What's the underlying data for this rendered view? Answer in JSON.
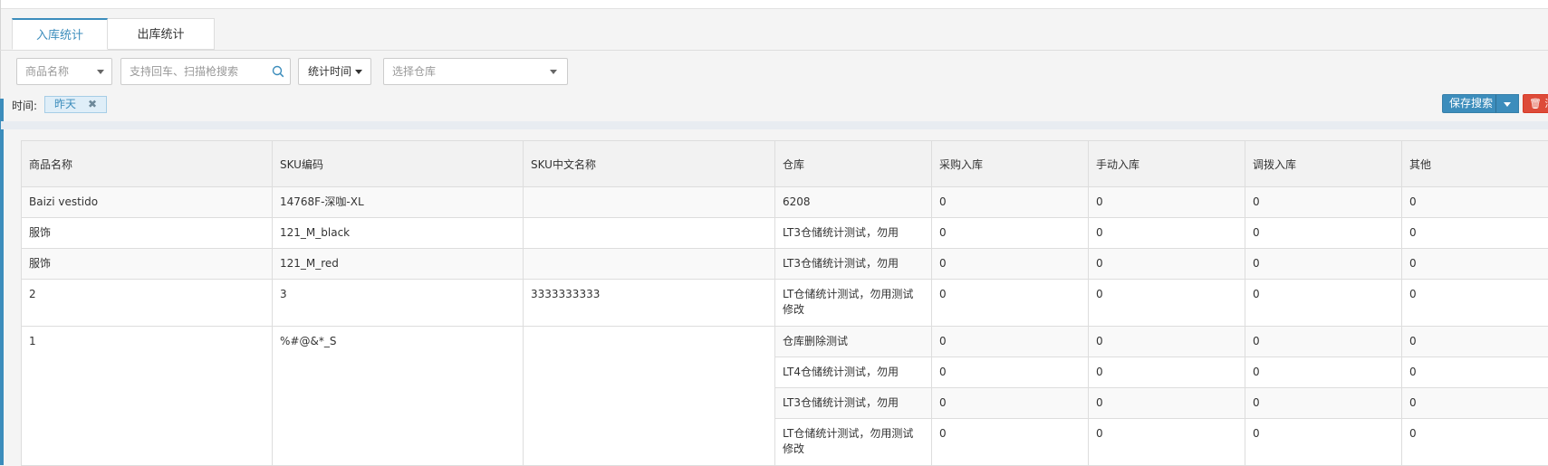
{
  "tabs": [
    {
      "label": "入库统计",
      "active": true
    },
    {
      "label": "出库统计",
      "active": false
    }
  ],
  "filters": {
    "product_select_placeholder": "商品名称",
    "search_placeholder": "支持回车、扫描枪搜索",
    "stat_time_label": "统计时间",
    "warehouse_placeholder": "选择仓库"
  },
  "time_filter": {
    "label": "时间:",
    "tag": "昨天",
    "tag_close": "✖"
  },
  "actions": {
    "save_search": "保存搜索",
    "delete_label": "🗑 清"
  },
  "colors": {
    "accent": "#3c8dbc",
    "danger": "#dd4b39"
  },
  "table": {
    "headers": [
      "商品名称",
      "SKU编码",
      "SKU中文名称",
      "仓库",
      "采购入库",
      "手动入库",
      "调拨入库",
      "其他"
    ],
    "rows": [
      {
        "name": "Baizi vestido",
        "sku": "14768F-深咖-XL",
        "cn_name": "",
        "warehouse": "6208",
        "purchase": "0",
        "manual": "0",
        "transfer": "0",
        "other": "0"
      },
      {
        "name": "服饰",
        "sku": "121_M_black",
        "cn_name": "",
        "warehouse": "LT3仓储统计测试，勿用",
        "purchase": "0",
        "manual": "0",
        "transfer": "0",
        "other": "0"
      },
      {
        "name": "服饰",
        "sku": "121_M_red",
        "cn_name": "",
        "warehouse": "LT3仓储统计测试，勿用",
        "purchase": "0",
        "manual": "0",
        "transfer": "0",
        "other": "0"
      },
      {
        "name": "2",
        "sku": "3",
        "cn_name": "3333333333",
        "warehouse": "LT仓储统计测试，勿用测试修改",
        "purchase": "0",
        "manual": "0",
        "transfer": "0",
        "other": "0"
      }
    ],
    "group": {
      "name": "1",
      "sku": "%#@&*_S",
      "cn_name": "",
      "sub_rows": [
        {
          "warehouse": "仓库删除测试",
          "purchase": "0",
          "manual": "0",
          "transfer": "0",
          "other": "0"
        },
        {
          "warehouse": "LT4仓储统计测试，勿用",
          "purchase": "0",
          "manual": "0",
          "transfer": "0",
          "other": "0"
        },
        {
          "warehouse": "LT3仓储统计测试，勿用",
          "purchase": "0",
          "manual": "0",
          "transfer": "0",
          "other": "0"
        },
        {
          "warehouse": "LT仓储统计测试，勿用测试修改",
          "purchase": "0",
          "manual": "0",
          "transfer": "0",
          "other": "0"
        }
      ]
    }
  }
}
